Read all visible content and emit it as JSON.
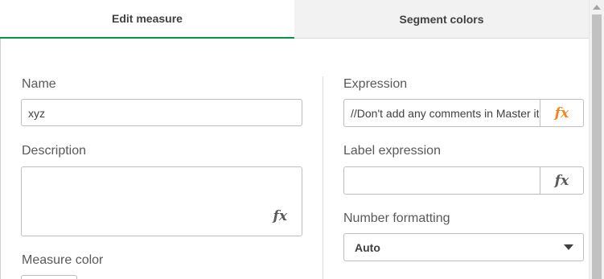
{
  "tabs": {
    "edit_measure": "Edit measure",
    "segment_colors": "Segment colors"
  },
  "left": {
    "name_label": "Name",
    "name_value": "xyz",
    "description_label": "Description",
    "description_value": "",
    "measure_color_label": "Measure color"
  },
  "right": {
    "expression_label": "Expression",
    "expression_value": "//Don't add any comments in Master items",
    "label_expression_label": "Label expression",
    "label_expression_value": "",
    "number_formatting_label": "Number formatting",
    "number_formatting_value": "Auto"
  },
  "fx_symbol": "fx",
  "colors": {
    "active_tab_underline": "#009845",
    "fx_highlight": "#f2851c",
    "inactive_tab_bg": "#f2f2f2"
  }
}
